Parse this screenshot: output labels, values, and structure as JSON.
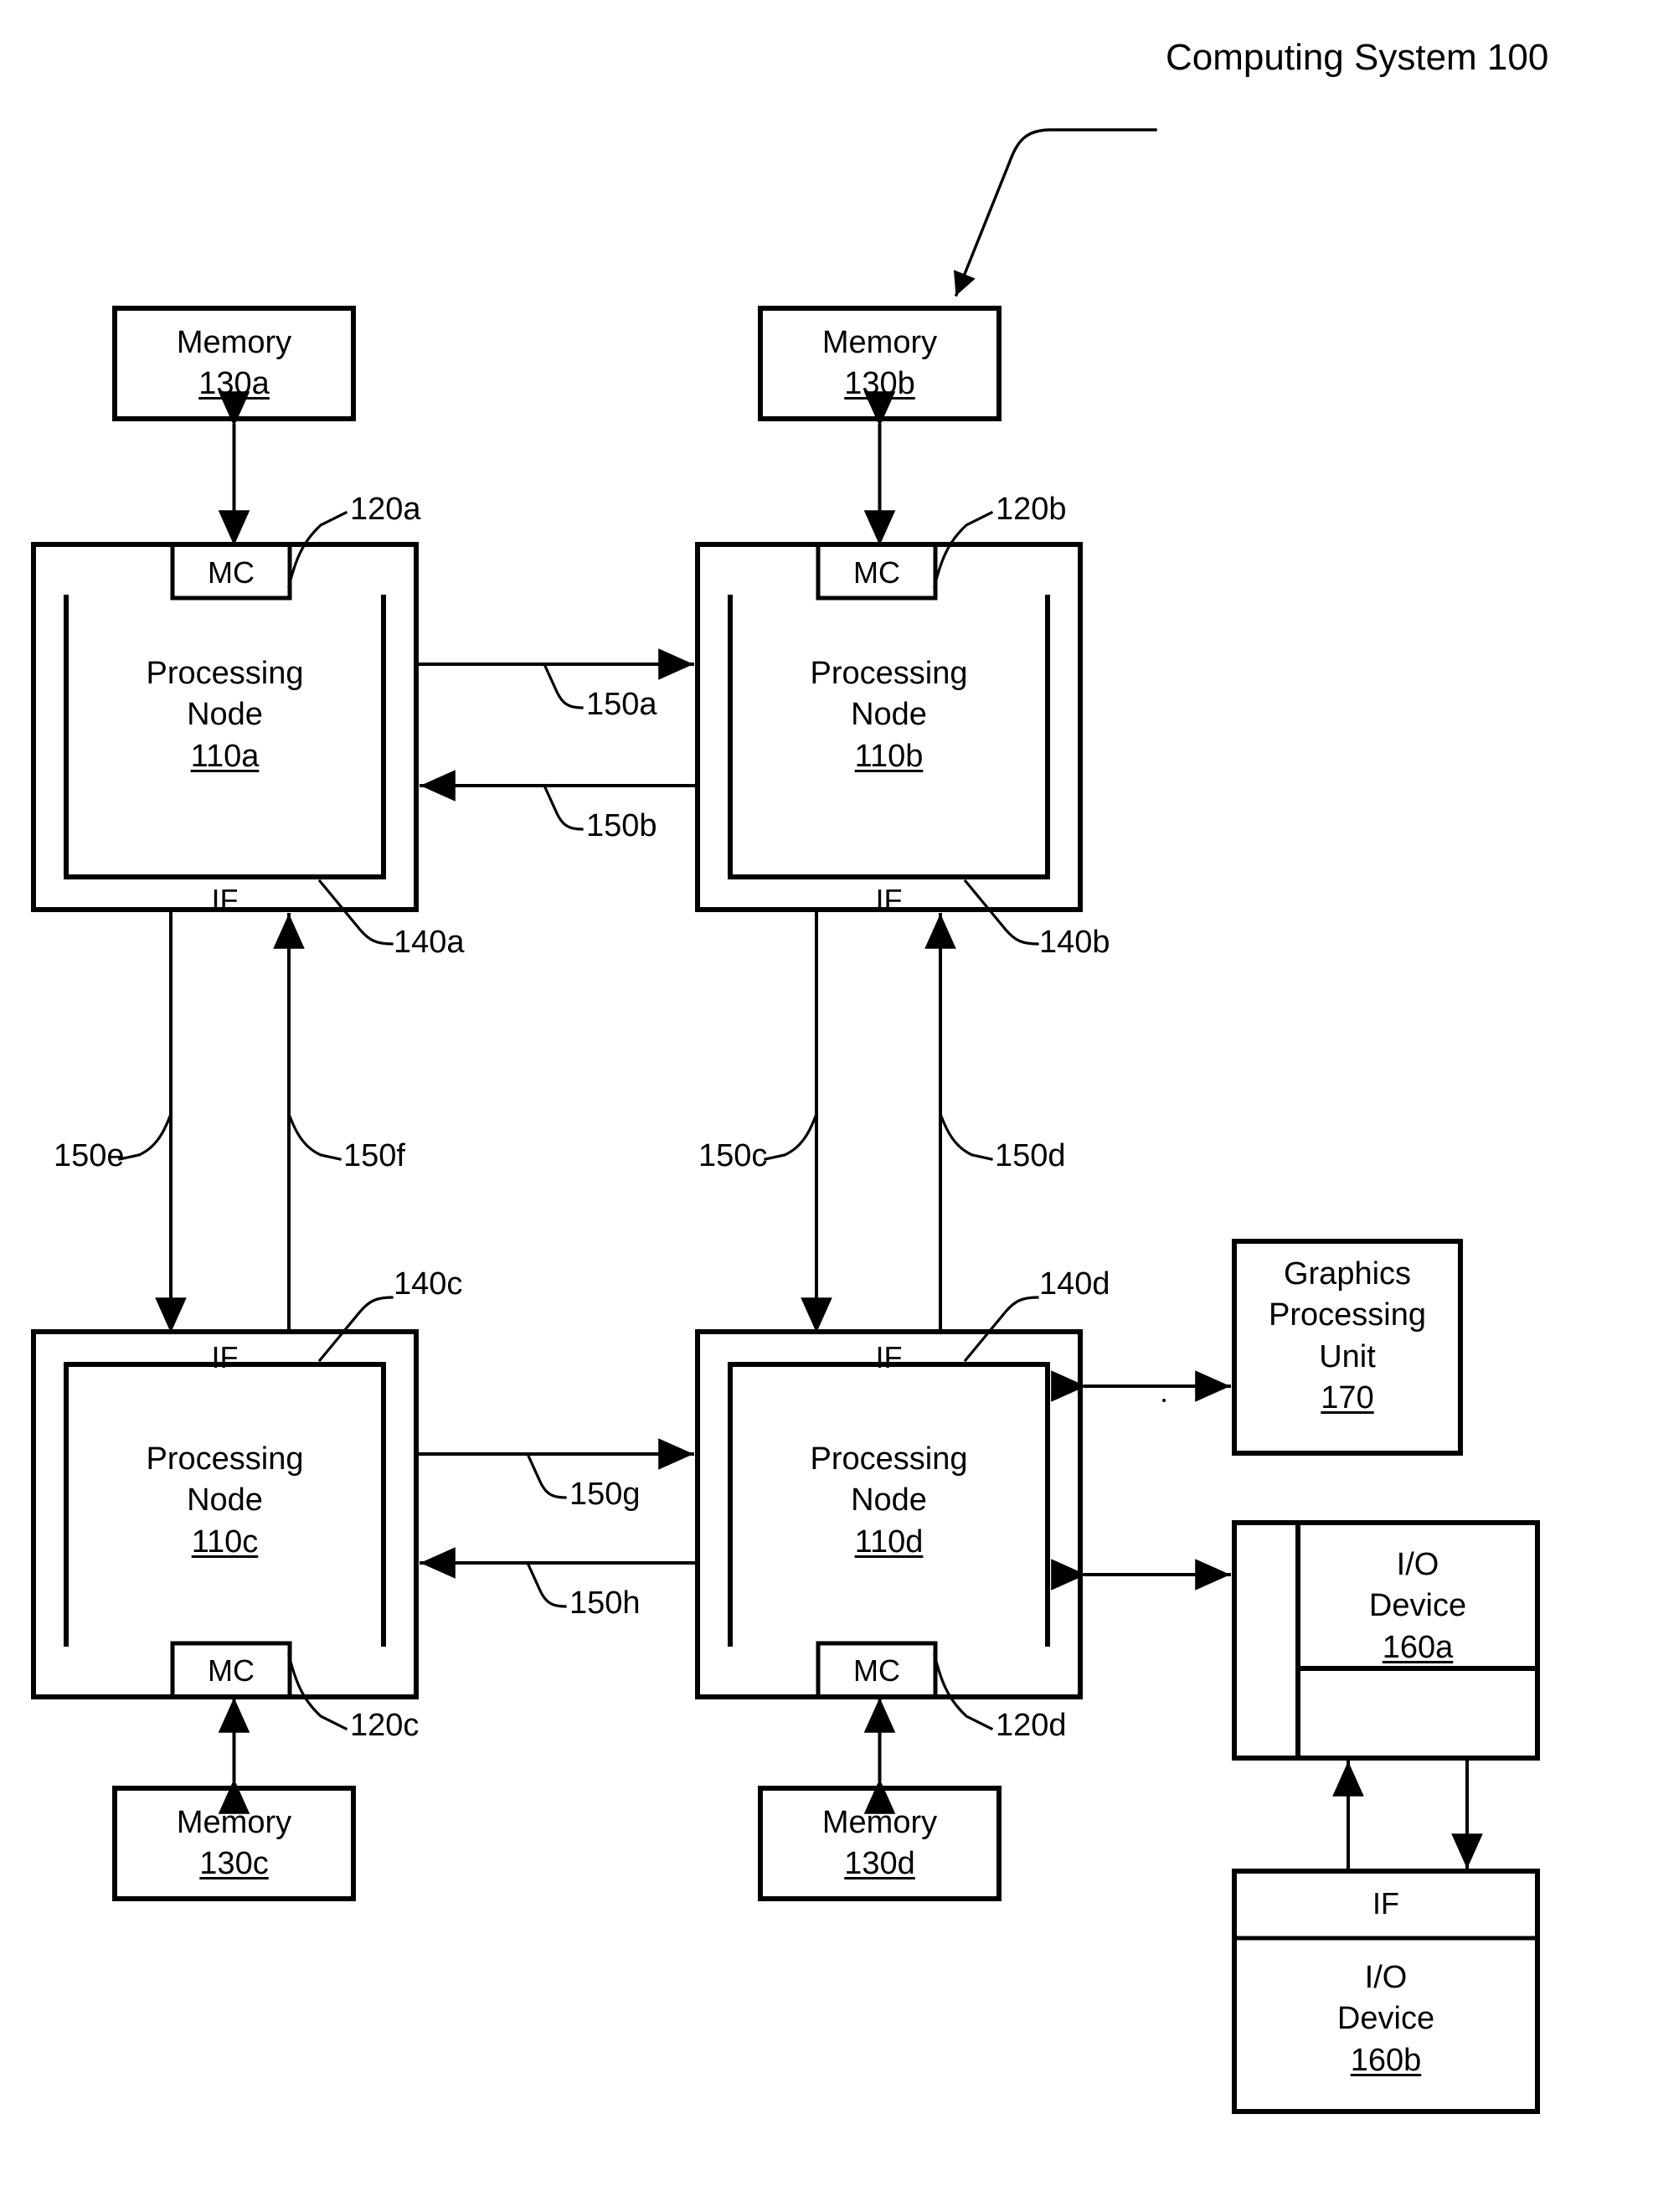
{
  "figure": {
    "title": "Computing System 100"
  },
  "memories": [
    {
      "id": "130a",
      "name": "Memory",
      "ref": "130a"
    },
    {
      "id": "130b",
      "name": "Memory",
      "ref": "130b"
    },
    {
      "id": "130c",
      "name": "Memory",
      "ref": "130c"
    },
    {
      "id": "130d",
      "name": "Memory",
      "ref": "130d"
    }
  ],
  "nodes": [
    {
      "id": "110a",
      "line1": "Processing",
      "line2": "Node",
      "ref": "110a",
      "mc": "MC",
      "if": "IF",
      "mc_ref": "120a",
      "if_ref": "140a"
    },
    {
      "id": "110b",
      "line1": "Processing",
      "line2": "Node",
      "ref": "110b",
      "mc": "MC",
      "if": "IF",
      "mc_ref": "120b",
      "if_ref": "140b"
    },
    {
      "id": "110c",
      "line1": "Processing",
      "line2": "Node",
      "ref": "110c",
      "mc": "MC",
      "if": "IF",
      "mc_ref": "120c",
      "if_ref": "140c"
    },
    {
      "id": "110d",
      "line1": "Processing",
      "line2": "Node",
      "ref": "110d",
      "mc": "MC",
      "if": "IF",
      "mc_ref": "120d",
      "if_ref": "140d"
    }
  ],
  "gpu": {
    "line1": "Graphics",
    "line2": "Processing",
    "line3": "Unit",
    "ref": "170"
  },
  "io_devices": [
    {
      "id": "160a",
      "line1": "I/O",
      "line2": "Device",
      "ref": "160a"
    },
    {
      "id": "160b",
      "line1": "I/O",
      "line2": "Device",
      "ref": "160b",
      "if": "IF"
    }
  ],
  "links": [
    {
      "ref": "150a",
      "from": "110a",
      "to": "110b",
      "dir": "right"
    },
    {
      "ref": "150b",
      "from": "110b",
      "to": "110a",
      "dir": "left"
    },
    {
      "ref": "150c",
      "from": "110b",
      "to": "110d",
      "dir": "down"
    },
    {
      "ref": "150d",
      "from": "110d",
      "to": "110b",
      "dir": "up"
    },
    {
      "ref": "150e",
      "from": "110a",
      "to": "110c",
      "dir": "down"
    },
    {
      "ref": "150f",
      "from": "110c",
      "to": "110a",
      "dir": "up"
    },
    {
      "ref": "150g",
      "from": "110c",
      "to": "110d",
      "dir": "right"
    },
    {
      "ref": "150h",
      "from": "110d",
      "to": "110c",
      "dir": "left"
    }
  ]
}
